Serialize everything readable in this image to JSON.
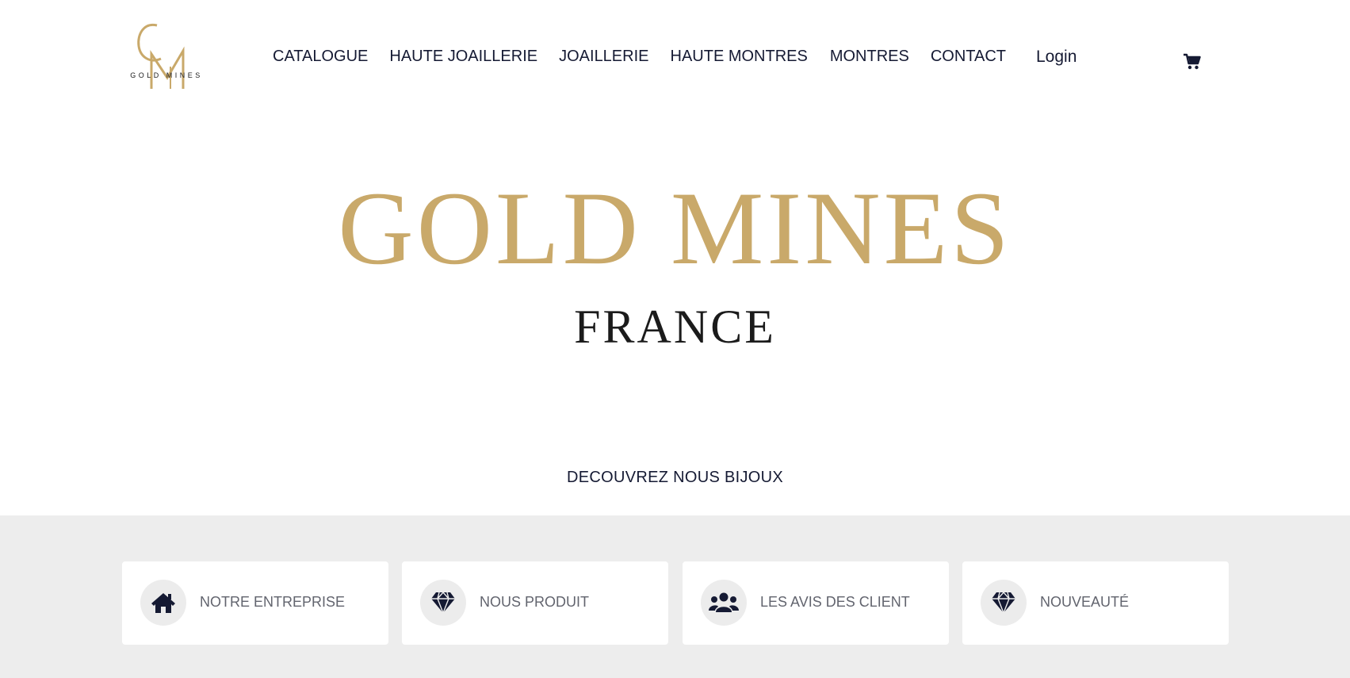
{
  "brand": {
    "logo_monogram": "GM",
    "logo_text": "GOLD MINES",
    "gold_color": "#c9a96a",
    "dark_color": "#151a33"
  },
  "nav": {
    "items": [
      {
        "label": "CATALOGUE"
      },
      {
        "label": "HAUTE JOAILLERIE"
      },
      {
        "label": "JOAILLERIE"
      },
      {
        "label": "HAUTE MONTRES"
      },
      {
        "label": "MONTRES"
      },
      {
        "label": "CONTACT"
      }
    ],
    "login_label": "Login",
    "cart_icon": "cart-icon"
  },
  "hero": {
    "title": "GOLD MINES",
    "subtitle": "FRANCE",
    "cta": "DECOUVREZ NOUS BIJOUX"
  },
  "features": {
    "background": "#ededed",
    "cards": [
      {
        "label": "NOTRE ENTREPRISE",
        "icon": "home-icon"
      },
      {
        "label": "NOUS PRODUIT",
        "icon": "diamond-icon"
      },
      {
        "label": "LES AVIS DES CLIENT",
        "icon": "users-icon"
      },
      {
        "label": "NOUVEAUTÉ",
        "icon": "diamond-icon"
      }
    ]
  }
}
